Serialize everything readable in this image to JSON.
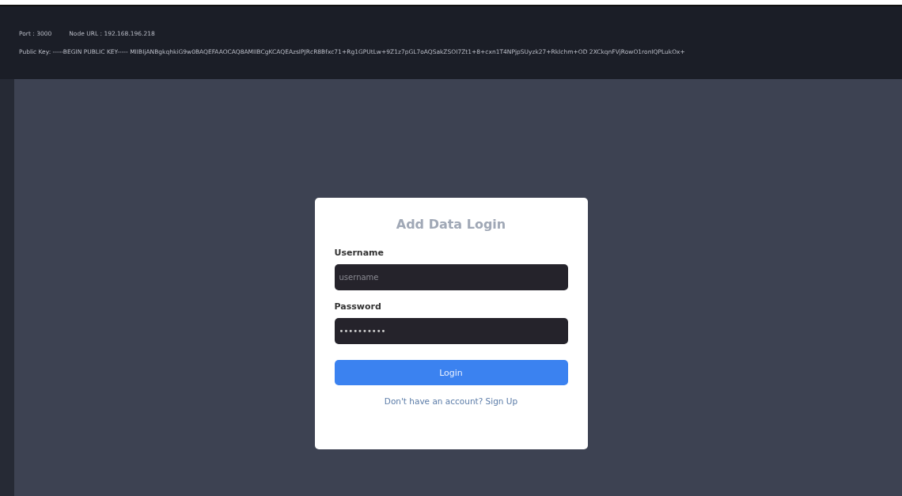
{
  "info_bar": {
    "port": "Port : 3000",
    "node_url": "Node URL : 192.168.196.218",
    "public_key": "Public Key: -----BEGIN PUBLIC KEY----- MIIBIjANBgkqhkiG9w0BAQEFAAOCAQ8AMIIBCgKCAQEAzsIPJRcR8Bfxc71+Rg1GPUtLw+9Z1z7pGL7oAQSakZSOI7Zt1+8+cxn1T4NPjpSUyzk27+RkIchm+OD 2XCkqnFVjRowO1ronIQPLukOx+"
  },
  "login_card": {
    "title": "Add Data Login",
    "fields": [
      {
        "label": "Username",
        "placeholder": "username"
      },
      {
        "label": "Password",
        "value": "••••••••••"
      }
    ],
    "submit": "Login",
    "signup_link": "Don't have an account? Sign Up"
  }
}
